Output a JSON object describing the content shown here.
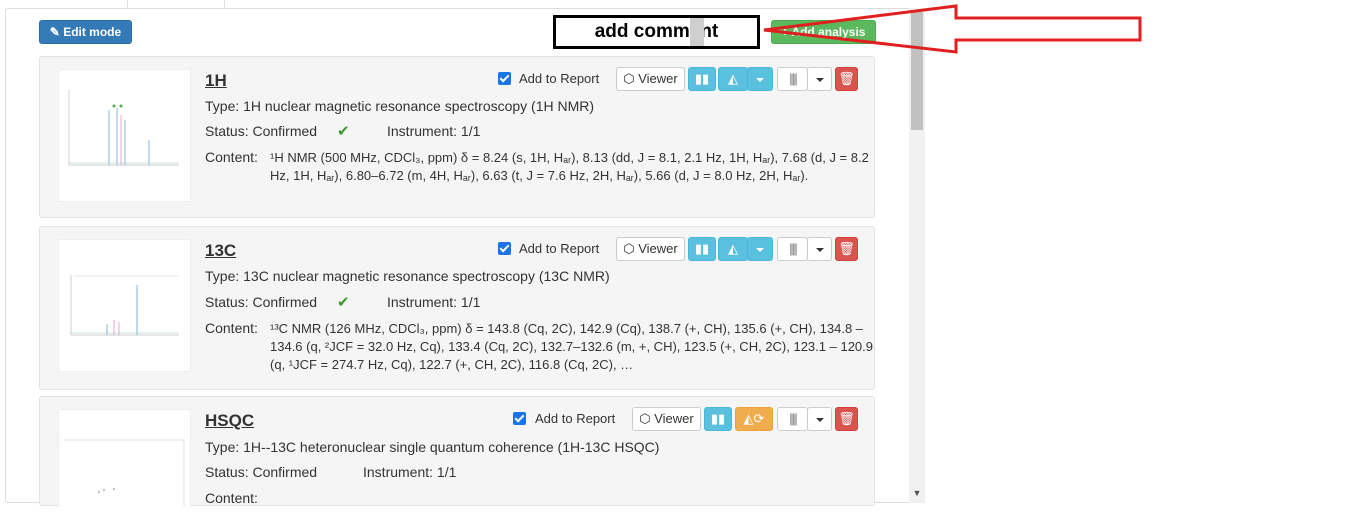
{
  "toolbar": {
    "edit_mode_label": "Edit mode",
    "add_analysis_label": "Add analysis"
  },
  "annotation": {
    "comment": "add comment",
    "arrow_color": "#e02020"
  },
  "colors": {
    "primary": "#337ab7",
    "success": "#5cb85c",
    "info": "#5bc0de",
    "warning": "#f0ad4e",
    "danger": "#d9534f",
    "confirmed_check": "#3c9a2c"
  },
  "cards": [
    {
      "title": "1H",
      "add_to_report": "Add to Report",
      "viewer": "Viewer",
      "type": "Type: 1H nuclear magnetic resonance spectroscopy (1H NMR)",
      "status": "Status: Confirmed",
      "instrument": "Instrument: 1/1",
      "content_label": "Content:",
      "content": "¹H NMR (500 MHz, CDCl₃, ppm) δ = 8.24 (s, 1H, Hₐᵣ), 8.13 (dd, J = 8.1, 2.1 Hz, 1H, Hₐᵣ), 7.68 (d, J = 8.2 Hz, 1H, Hₐᵣ), 6.80–6.72 (m, 4H, Hₐᵣ), 6.63 (t, J = 7.6 Hz, 2H, Hₐᵣ), 5.66 (d, J = 8.0 Hz, 2H, Hₐᵣ)."
    },
    {
      "title": "13C",
      "add_to_report": "Add to Report",
      "viewer": "Viewer",
      "type": "Type: 13C nuclear magnetic resonance spectroscopy (13C NMR)",
      "status": "Status: Confirmed",
      "instrument": "Instrument: 1/1",
      "content_label": "Content:",
      "content": "¹³C NMR (126 MHz, CDCl₃, ppm) δ = 143.8 (Cq, 2C), 142.9 (Cq), 138.7 (+, CH), 135.6 (+, CH), 134.8 – 134.6 (q, ²JCF = 32.0 Hz, Cq), 133.4 (Cq, 2C), 132.7–132.6 (m, +, CH), 123.5 (+, CH, 2C), 123.1 – 120.9 (q, ¹JCF = 274.7 Hz, Cq), 122.7 (+, CH, 2C), 116.8 (Cq, 2C), …"
    },
    {
      "title": "HSQC",
      "add_to_report": "Add to Report",
      "viewer": "Viewer",
      "type": "Type: 1H--13C heteronuclear single quantum coherence (1H-13C HSQC)",
      "status": "Status: Confirmed",
      "instrument": "Instrument: 1/1",
      "content_label": "Content:",
      "content": ""
    }
  ]
}
